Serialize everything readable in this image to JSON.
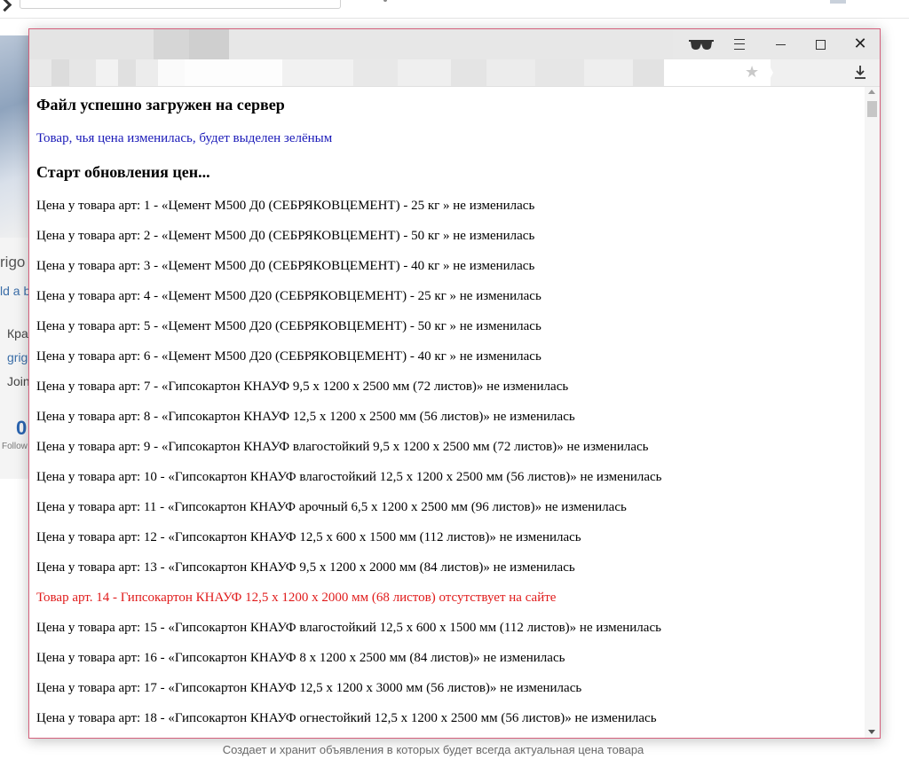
{
  "background": {
    "fragments": [
      "rigo",
      "ld a b",
      "Кра",
      "grig",
      "Join"
    ],
    "follow_count": "0",
    "follow_label": "Follow",
    "caption": "Создает и хранит объявления в которых будет всегда актуальная цена товара"
  },
  "window": {
    "icons": {
      "reading_mode": "glasses-icon",
      "menu": "hamburger-icon",
      "minimize": "minimize-icon",
      "maximize": "maximize-icon",
      "close": "close-icon",
      "bookmark": "star-icon",
      "download": "download-icon"
    },
    "close_glyph": "✕",
    "star_glyph": "★"
  },
  "content": {
    "heading_upload": "Файл успешно загружен на сервер",
    "note": "Товар, чья цена изменилась, будет выделен зелёным",
    "heading_start": "Старт обновления цен...",
    "lines": [
      {
        "text": "Цена у товара арт: 1 - «Цемент М500 Д0 (СЕБРЯКОВЦЕМЕНТ) - 25 кг » не изменилась",
        "status": "unchanged"
      },
      {
        "text": "Цена у товара арт: 2 - «Цемент М500 Д0 (СЕБРЯКОВЦЕМЕНТ) - 50 кг » не изменилась",
        "status": "unchanged"
      },
      {
        "text": "Цена у товара арт: 3 - «Цемент М500 Д0 (СЕБРЯКОВЦЕМЕНТ) - 40 кг » не изменилась",
        "status": "unchanged"
      },
      {
        "text": "Цена у товара арт: 4 - «Цемент М500 Д20 (СЕБРЯКОВЦЕМЕНТ) - 25 кг » не изменилась",
        "status": "unchanged"
      },
      {
        "text": "Цена у товара арт: 5 - «Цемент М500 Д20 (СЕБРЯКОВЦЕМЕНТ) - 50 кг » не изменилась",
        "status": "unchanged"
      },
      {
        "text": "Цена у товара арт: 6 - «Цемент М500 Д20 (СЕБРЯКОВЦЕМЕНТ) - 40 кг » не изменилась",
        "status": "unchanged"
      },
      {
        "text": "Цена у товара арт: 7 - «Гипсокартон КНАУФ 9,5 х 1200 х 2500 мм (72 листов)» не изменилась",
        "status": "unchanged"
      },
      {
        "text": "Цена у товара арт: 8 - «Гипсокартон КНАУФ 12,5 х 1200 х 2500 мм (56 листов)» не изменилась",
        "status": "unchanged"
      },
      {
        "text": "Цена у товара арт: 9 - «Гипсокартон КНАУФ влагостойкий 9,5 х 1200 х 2500 мм (72 листов)» не изменилась",
        "status": "unchanged"
      },
      {
        "text": "Цена у товара арт: 10 - «Гипсокартон КНАУФ влагостойкий 12,5 х 1200 х 2500 мм (56 листов)» не изменилась",
        "status": "unchanged"
      },
      {
        "text": "Цена у товара арт: 11 - «Гипсокартон КНАУФ арочный 6,5 х 1200 х 2500 мм (96 листов)» не изменилась",
        "status": "unchanged"
      },
      {
        "text": "Цена у товара арт: 12 - «Гипсокартон КНАУФ 12,5 х 600 х 1500 мм (112 листов)» не изменилась",
        "status": "unchanged"
      },
      {
        "text": "Цена у товара арт: 13 - «Гипсокартон КНАУФ 9,5 х 1200 х 2000 мм (84 листов)» не изменилась",
        "status": "unchanged"
      },
      {
        "text": "Товар арт. 14 - Гипсокартон КНАУФ 12,5 х 1200 х 2000 мм (68 листов) отсутствует на сайте",
        "status": "missing"
      },
      {
        "text": "Цена у товара арт: 15 - «Гипсокартон КНАУФ влагостойкий 12,5 х 600 х 1500 мм (112 листов)» не изменилась",
        "status": "unchanged"
      },
      {
        "text": "Цена у товара арт: 16 - «Гипсокартон КНАУФ 8 х 1200 х 2500 мм (84 листов)» не изменилась",
        "status": "unchanged"
      },
      {
        "text": "Цена у товара арт: 17 - «Гипсокартон КНАУФ 12,5 х 1200 х 3000 мм (56 листов)» не изменилась",
        "status": "unchanged"
      },
      {
        "text": "Цена у товара арт: 18 - «Гипсокартон КНАУФ огнестойкий 12,5 х 1200 х 2500 мм (56 листов)» не изменилась",
        "status": "unchanged"
      }
    ]
  },
  "colors": {
    "note": "#1a1ab8",
    "missing": "#e01b1b",
    "window_border": "#d4607c"
  }
}
